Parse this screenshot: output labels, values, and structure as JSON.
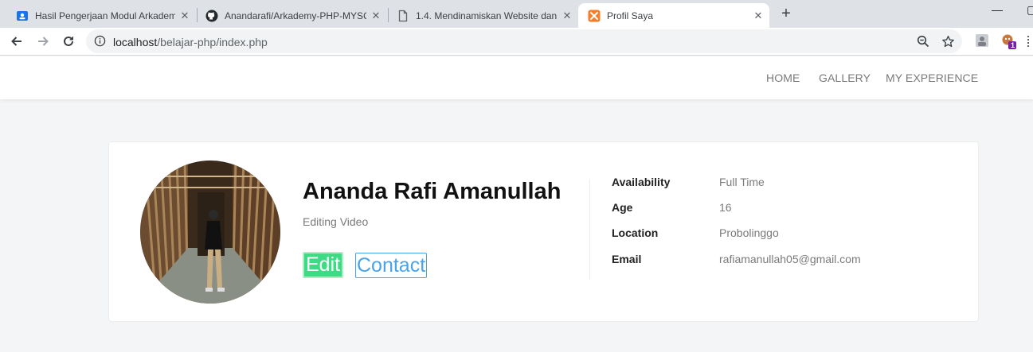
{
  "browser": {
    "tabs": [
      {
        "title": "Hasil Pengerjaan Modul Arkademy",
        "icon": "classroom-icon",
        "active": false
      },
      {
        "title": "Anandarafi/Arkademy-PHP-MYSQL",
        "icon": "github-icon",
        "active": false
      },
      {
        "title": "1.4. Mendinamiskan Website dan",
        "icon": "document-icon",
        "active": false
      },
      {
        "title": "Profil Saya",
        "icon": "xampp-icon",
        "active": true
      }
    ],
    "url_host": "localhost",
    "url_path": "/belajar-php/index.php",
    "extension_badge": "1"
  },
  "nav": {
    "items": [
      "HOME",
      "GALLERY",
      "MY EXPERIENCE"
    ]
  },
  "profile": {
    "name": "Ananda Rafi Amanullah",
    "role": "Editing Video",
    "edit_label": "Edit",
    "contact_label": "Contact",
    "details": [
      {
        "label": "Availability",
        "value": "Full Time"
      },
      {
        "label": "Age",
        "value": "16"
      },
      {
        "label": "Location",
        "value": "Probolinggo"
      },
      {
        "label": "Email",
        "value": "rafiamanullah05@gmail.com"
      }
    ]
  },
  "colors": {
    "edit_button": "#3ddc84",
    "contact_button": "#4aa3e8",
    "page_background": "#f4f5f7"
  }
}
